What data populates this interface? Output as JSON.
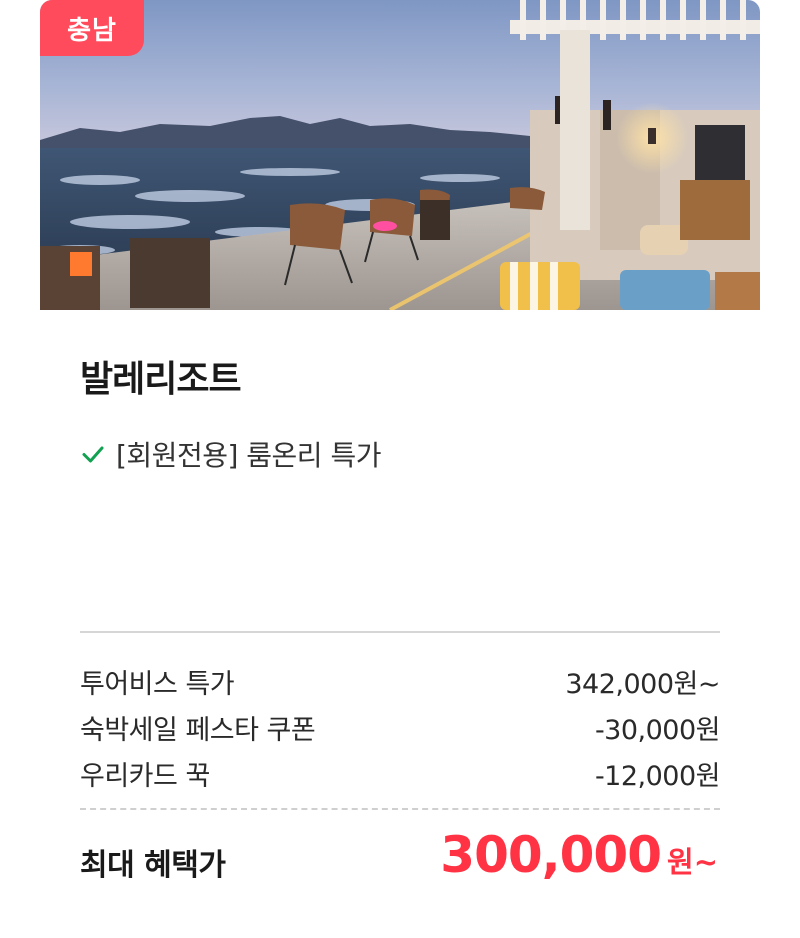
{
  "hotel": {
    "region_badge": "충남",
    "name": "발레리조트",
    "benefit": "[회원전용] 룸온리 특가",
    "image": "resort-terrace-sea-view-photo"
  },
  "pricing": {
    "rows": [
      {
        "label": "투어비스 특가",
        "value": "342,000원~"
      },
      {
        "label": "숙박세일 페스타 쿠폰",
        "value": "-30,000원"
      },
      {
        "label": "우리카드 꾹",
        "value": "-12,000원"
      }
    ],
    "final_label": "최대 혜택가",
    "final_amount": "300,000",
    "final_unit": "원~"
  },
  "colors": {
    "accent": "#ff3344",
    "badge": "#ff4b5c",
    "check": "#12a150"
  }
}
